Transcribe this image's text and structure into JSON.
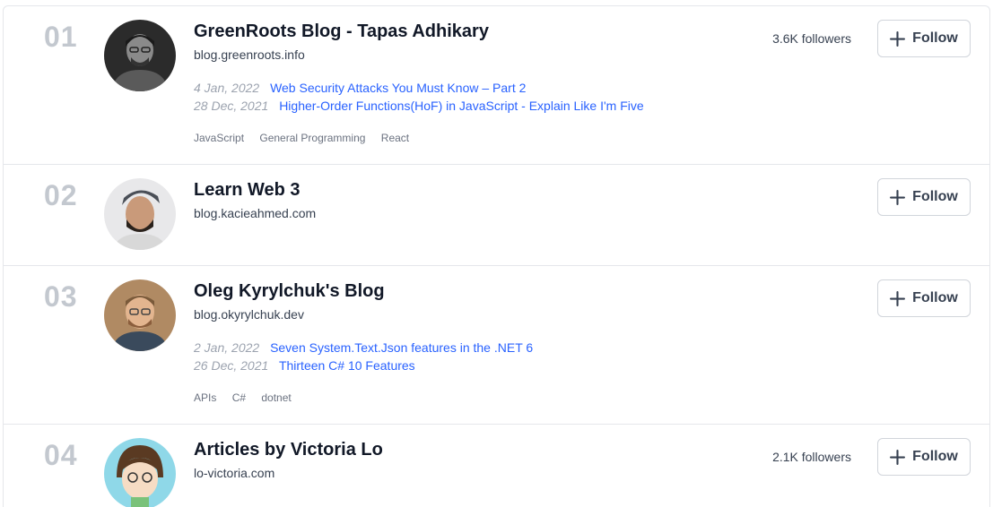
{
  "follow_label": "Follow",
  "blogs": [
    {
      "rank": "01",
      "title": "GreenRoots Blog - Tapas Adhikary",
      "domain": "blog.greenroots.info",
      "followers": "3.6K followers",
      "posts": [
        {
          "date": "4 Jan, 2022",
          "title": "Web Security Attacks You Must Know – Part 2"
        },
        {
          "date": "28 Dec, 2021",
          "title": "Higher-Order Functions(HoF) in JavaScript - Explain Like I'm Five"
        }
      ],
      "tags": [
        "JavaScript",
        "General Programming",
        "React"
      ]
    },
    {
      "rank": "02",
      "title": "Learn Web 3",
      "domain": "blog.kacieahmed.com",
      "followers": "",
      "posts": [],
      "tags": []
    },
    {
      "rank": "03",
      "title": "Oleg Kyrylchuk's Blog",
      "domain": "blog.okyrylchuk.dev",
      "followers": "",
      "posts": [
        {
          "date": "2 Jan, 2022",
          "title": "Seven System.Text.Json features in the .NET 6"
        },
        {
          "date": "26 Dec, 2021",
          "title": "Thirteen C# 10 Features"
        }
      ],
      "tags": [
        "APIs",
        "C#",
        "dotnet"
      ]
    },
    {
      "rank": "04",
      "title": "Articles by Victoria Lo",
      "domain": "lo-victoria.com",
      "followers": "2.1K followers",
      "posts": [],
      "tags": []
    }
  ],
  "colors": {
    "link": "#2962ff",
    "rank": "#c3c8cf",
    "border": "#e5e7eb"
  },
  "icons": {
    "follow": "plus-icon",
    "avatar": "avatar-photo"
  }
}
